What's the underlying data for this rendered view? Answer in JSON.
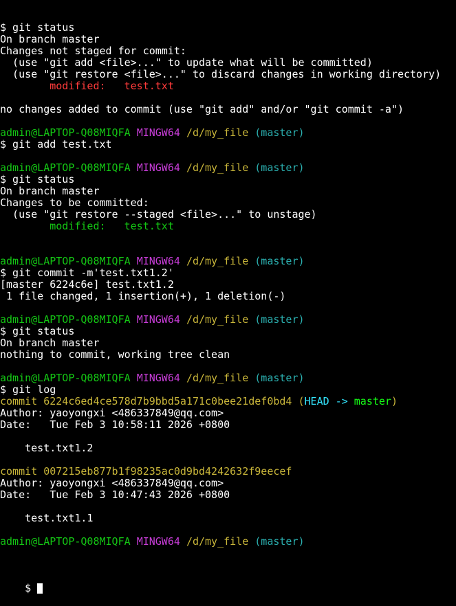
{
  "colors": {
    "background": "#000000",
    "text": "#ffffff",
    "red": "#ff3b3b",
    "green": "#14c714",
    "magenta": "#c83dd8",
    "yellow": "#c9b63a",
    "cyan": "#2bb0b0",
    "bright_cyan": "#33e6ff",
    "bright_green": "#16ff16"
  },
  "terminal": {
    "lines": [
      [
        {
          "t": "$ git status",
          "c": "text"
        }
      ],
      [
        {
          "t": "On branch master",
          "c": "text"
        }
      ],
      [
        {
          "t": "Changes not staged for commit:",
          "c": "text"
        }
      ],
      [
        {
          "t": "  (use \"git add <file>...\" to update what will be committed)",
          "c": "text"
        }
      ],
      [
        {
          "t": "  (use \"git restore <file>...\" to discard changes in working directory)",
          "c": "text"
        }
      ],
      [
        {
          "t": "        modified:   test.txt",
          "c": "red"
        }
      ],
      [],
      [
        {
          "t": "no changes added to commit (use \"git add\" and/or \"git commit -a\")",
          "c": "text"
        }
      ],
      [],
      [
        {
          "t": "admin@LAPTOP-Q08MIQFA ",
          "c": "green"
        },
        {
          "t": "MINGW64 ",
          "c": "magenta"
        },
        {
          "t": "/d/my_file ",
          "c": "yellow"
        },
        {
          "t": "(master)",
          "c": "cyan"
        }
      ],
      [
        {
          "t": "$ git add test.txt",
          "c": "text"
        }
      ],
      [],
      [
        {
          "t": "admin@LAPTOP-Q08MIQFA ",
          "c": "green"
        },
        {
          "t": "MINGW64 ",
          "c": "magenta"
        },
        {
          "t": "/d/my_file ",
          "c": "yellow"
        },
        {
          "t": "(master)",
          "c": "cyan"
        }
      ],
      [
        {
          "t": "$ git status",
          "c": "text"
        }
      ],
      [
        {
          "t": "On branch master",
          "c": "text"
        }
      ],
      [
        {
          "t": "Changes to be committed:",
          "c": "text"
        }
      ],
      [
        {
          "t": "  (use \"git restore --staged <file>...\" to unstage)",
          "c": "text"
        }
      ],
      [
        {
          "t": "        modified:   test.txt",
          "c": "green"
        }
      ],
      [],
      [],
      [
        {
          "t": "admin@LAPTOP-Q08MIQFA ",
          "c": "green"
        },
        {
          "t": "MINGW64 ",
          "c": "magenta"
        },
        {
          "t": "/d/my_file ",
          "c": "yellow"
        },
        {
          "t": "(master)",
          "c": "cyan"
        }
      ],
      [
        {
          "t": "$ git commit -m'test.txt1.2'",
          "c": "text"
        }
      ],
      [
        {
          "t": "[master 6224c6e] test.txt1.2",
          "c": "text"
        }
      ],
      [
        {
          "t": " 1 file changed, 1 insertion(+), 1 deletion(-)",
          "c": "text"
        }
      ],
      [],
      [
        {
          "t": "admin@LAPTOP-Q08MIQFA ",
          "c": "green"
        },
        {
          "t": "MINGW64 ",
          "c": "magenta"
        },
        {
          "t": "/d/my_file ",
          "c": "yellow"
        },
        {
          "t": "(master)",
          "c": "cyan"
        }
      ],
      [
        {
          "t": "$ git status",
          "c": "text"
        }
      ],
      [
        {
          "t": "On branch master",
          "c": "text"
        }
      ],
      [
        {
          "t": "nothing to commit, working tree clean",
          "c": "text"
        }
      ],
      [],
      [
        {
          "t": "admin@LAPTOP-Q08MIQFA ",
          "c": "green"
        },
        {
          "t": "MINGW64 ",
          "c": "magenta"
        },
        {
          "t": "/d/my_file ",
          "c": "yellow"
        },
        {
          "t": "(master)",
          "c": "cyan"
        }
      ],
      [
        {
          "t": "$ git log",
          "c": "text"
        }
      ],
      [
        {
          "t": "commit 6224c6ed4ce578d7b9bbd5a171c0bee21def0bd4 ",
          "c": "yellow"
        },
        {
          "t": "(",
          "c": "yellow"
        },
        {
          "t": "HEAD -> ",
          "c": "bright_cyan"
        },
        {
          "t": "master",
          "c": "bright_green"
        },
        {
          "t": ")",
          "c": "yellow"
        }
      ],
      [
        {
          "t": "Author: yaoyongxi <486337849@qq.com>",
          "c": "text"
        }
      ],
      [
        {
          "t": "Date:   Tue Feb 3 10:58:11 2026 +0800",
          "c": "text"
        }
      ],
      [],
      [
        {
          "t": "    test.txt1.2",
          "c": "text"
        }
      ],
      [],
      [
        {
          "t": "commit 007215eb877b1f98235ac0d9bd4242632f9eecef",
          "c": "yellow"
        }
      ],
      [
        {
          "t": "Author: yaoyongxi <486337849@qq.com>",
          "c": "text"
        }
      ],
      [
        {
          "t": "Date:   Tue Feb 3 10:47:43 2026 +0800",
          "c": "text"
        }
      ],
      [],
      [
        {
          "t": "    test.txt1.1",
          "c": "text"
        }
      ],
      [],
      [
        {
          "t": "admin@LAPTOP-Q08MIQFA ",
          "c": "green"
        },
        {
          "t": "MINGW64 ",
          "c": "magenta"
        },
        {
          "t": "/d/my_file ",
          "c": "yellow"
        },
        {
          "t": "(master)",
          "c": "cyan"
        }
      ]
    ],
    "prompt_symbol": "$ "
  }
}
